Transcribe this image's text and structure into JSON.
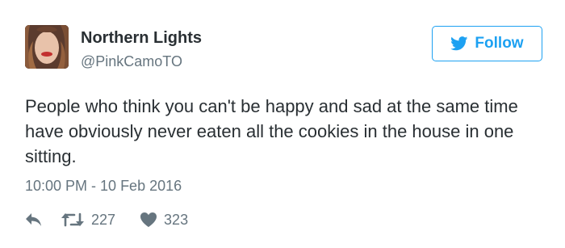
{
  "user": {
    "display_name": "Northern Lights",
    "handle": "@PinkCamoTO"
  },
  "follow_button": {
    "label": "Follow",
    "icon": "twitter-bird-icon",
    "color": "#1da1f2"
  },
  "tweet": {
    "text": "People who think you can't be happy and sad at the same time have obviously never eaten all the cookies in the house in one sitting.",
    "timestamp": "10:00 PM - 10 Feb 2016"
  },
  "actions": {
    "reply_icon": "reply-icon",
    "retweet_icon": "retweet-icon",
    "retweet_count": "227",
    "like_icon": "heart-icon",
    "like_count": "323"
  }
}
